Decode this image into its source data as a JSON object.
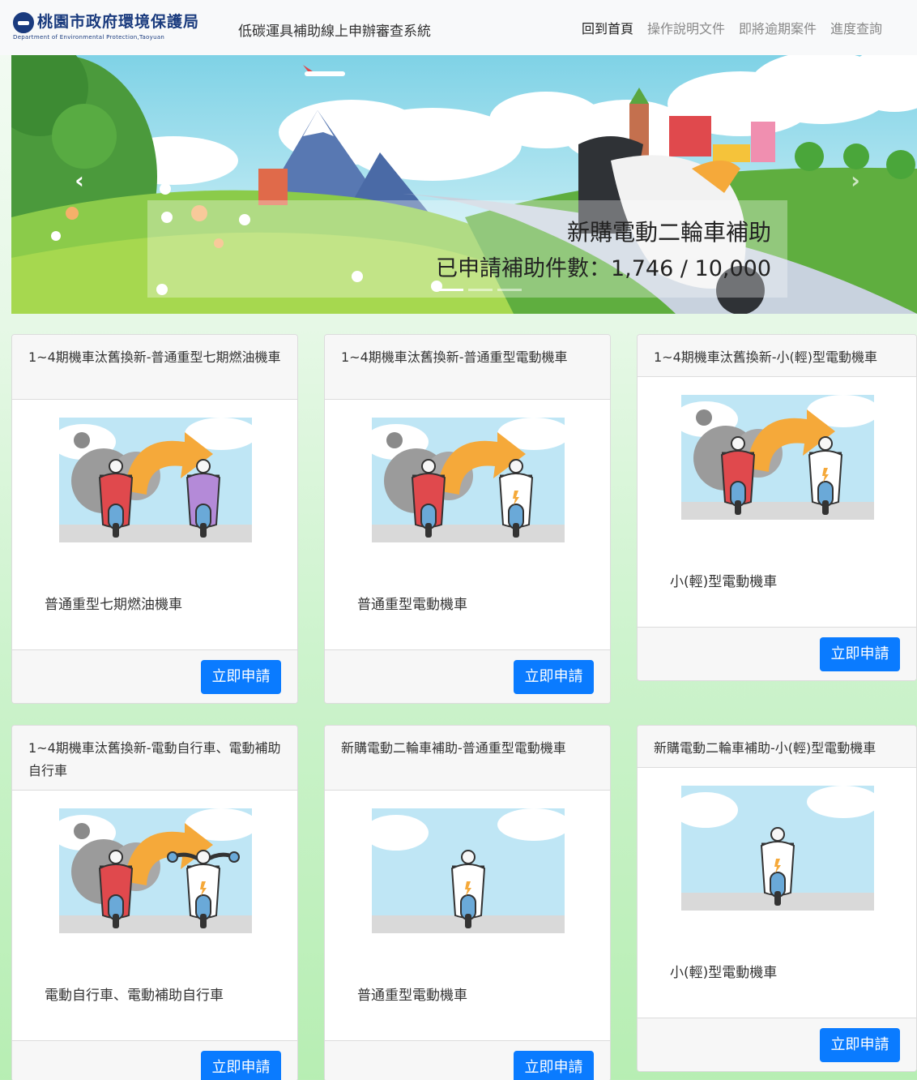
{
  "brand": {
    "name": "桃園市政府環境保護局",
    "name_en": "Department of Environmental Protection,Taoyuan"
  },
  "site_title": "低碳運具補助線上申辦審查系統",
  "nav": [
    {
      "label": "回到首頁",
      "active": true
    },
    {
      "label": "操作說明文件",
      "active": false
    },
    {
      "label": "即將逾期案件",
      "active": false
    },
    {
      "label": "進度查詢",
      "active": false
    }
  ],
  "hero": {
    "title": "新購電動二輪車補助",
    "subtitle": "已申請補助件數：1,746 / 10,000",
    "applied": 1746,
    "quota": 10000,
    "prev_icon": "chevron-left-icon",
    "next_icon": "chevron-right-icon",
    "slides": 3,
    "active_slide": 1
  },
  "cards": [
    {
      "title": "1~4期機車汰舊換新-普通重型七期燃油機車",
      "text": "普通重型七期燃油機車",
      "button": "立即申請",
      "image": "swap-to-fuel-scooter",
      "new_color": "#b48ad8"
    },
    {
      "title": "1~4期機車汰舊換新-普通重型電動機車",
      "text": "普通重型電動機車",
      "button": "立即申請",
      "image": "swap-to-electric-scooter",
      "new_color": "#ffffff"
    },
    {
      "title": "1~4期機車汰舊換新-小(輕)型電動機車",
      "text": "小(輕)型電動機車",
      "button": "立即申請",
      "image": "swap-to-light-electric-scooter",
      "new_color": "#ffffff"
    },
    {
      "title": "1~4期機車汰舊換新-電動自行車、電動補助自行車",
      "text": "電動自行車、電動補助自行車",
      "button": "立即申請",
      "image": "swap-to-electric-bicycle",
      "new_color": "#ffffff"
    },
    {
      "title": "新購電動二輪車補助-普通重型電動機車",
      "text": "普通重型電動機車",
      "button": "立即申請",
      "image": "new-electric-scooter",
      "new_color": "#ffffff"
    },
    {
      "title": "新購電動二輪車補助-小(輕)型電動機車",
      "text": "小(輕)型電動機車",
      "button": "立即申請",
      "image": "new-light-electric-scooter",
      "new_color": "#ffffff"
    }
  ],
  "colors": {
    "primary_button": "#0a7bff",
    "brand_blue": "#1a3b7e",
    "old_scooter": "#e0494d",
    "arrow_orange": "#f5a93a"
  }
}
